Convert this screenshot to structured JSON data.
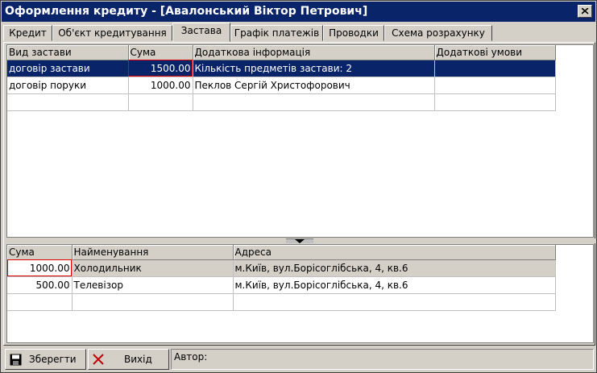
{
  "window": {
    "title": "Оформлення кредиту - [Авалонський Віктор Петрович]"
  },
  "tabs": [
    {
      "label": "Кредит"
    },
    {
      "label": "Об'єкт кредитування"
    },
    {
      "label": "Застава"
    },
    {
      "label": "Графік платежів"
    },
    {
      "label": "Проводки"
    },
    {
      "label": "Схема розрахунку"
    }
  ],
  "active_tab": "Застава",
  "collateral_grid": {
    "columns": [
      "Вид застави",
      "Сума",
      "Додаткова інформація",
      "Додаткові умови"
    ],
    "rows": [
      {
        "type": "договір застави",
        "amount": "1500.00",
        "info": "Кількість предметів застави: 2",
        "terms": ""
      },
      {
        "type": "договір поруки",
        "amount": "1000.00",
        "info": "Пеклов Сергій Христофорович",
        "terms": ""
      }
    ]
  },
  "items_grid": {
    "columns": [
      "Сума",
      "Найменування",
      "Адреса"
    ],
    "rows": [
      {
        "amount": "1000.00",
        "name": "Холодильник",
        "address": "м.Київ, вул.Борісоглібська, 4, кв.6"
      },
      {
        "amount": "500.00",
        "name": "Телевізор",
        "address": "м.Київ, вул.Борісоглібська, 4, кв.6"
      }
    ]
  },
  "statusbar": {
    "save_label": "Зберегти",
    "exit_label": "Вихід",
    "author_label": "Автор:"
  },
  "colors": {
    "title_bar": "#0a246a",
    "selection": "#0a246a",
    "face": "#d4d0c8",
    "focus_border": "#e00000"
  }
}
